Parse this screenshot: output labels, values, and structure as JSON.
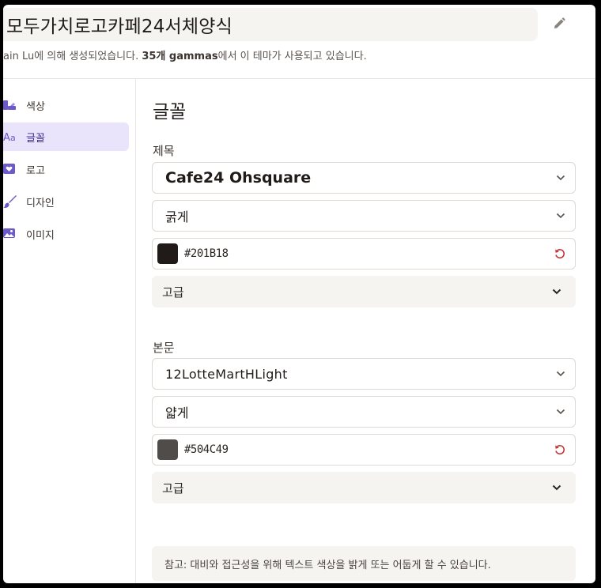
{
  "header": {
    "title": "모두가치로고카페24서체양식",
    "meta_prefix": "ain Lu에 의해 생성되었습니다. ",
    "meta_bold": "35개 gammas",
    "meta_suffix": "에서 이 테마가 사용되고 있습니다."
  },
  "sidebar": {
    "items": [
      {
        "label": "색상",
        "icon": "palette-icon"
      },
      {
        "label": "글꼴",
        "icon": "font-icon"
      },
      {
        "label": "로고",
        "icon": "heart-icon"
      },
      {
        "label": "디자인",
        "icon": "brush-icon"
      },
      {
        "label": "이미지",
        "icon": "image-icon"
      }
    ],
    "active_index": 1
  },
  "main": {
    "heading": "글꼴",
    "title_section": {
      "label": "제목",
      "font": "Cafe24 Ohsquare",
      "weight": "굵게",
      "color_hex": "#201B18",
      "color": "#201b18",
      "advanced": "고급"
    },
    "body_section": {
      "label": "본문",
      "font": "12LotteMartHLight",
      "weight": "얇게",
      "color_hex": "#504C49",
      "color": "#504c49",
      "advanced": "고급"
    },
    "note": "참고: 대비와 접근성을 위해 텍스트 색상을 밝게 또는 어둡게 할 수 있습니다."
  },
  "colors": {
    "accent": "#e9e3fb",
    "reset_icon": "#c53030"
  }
}
